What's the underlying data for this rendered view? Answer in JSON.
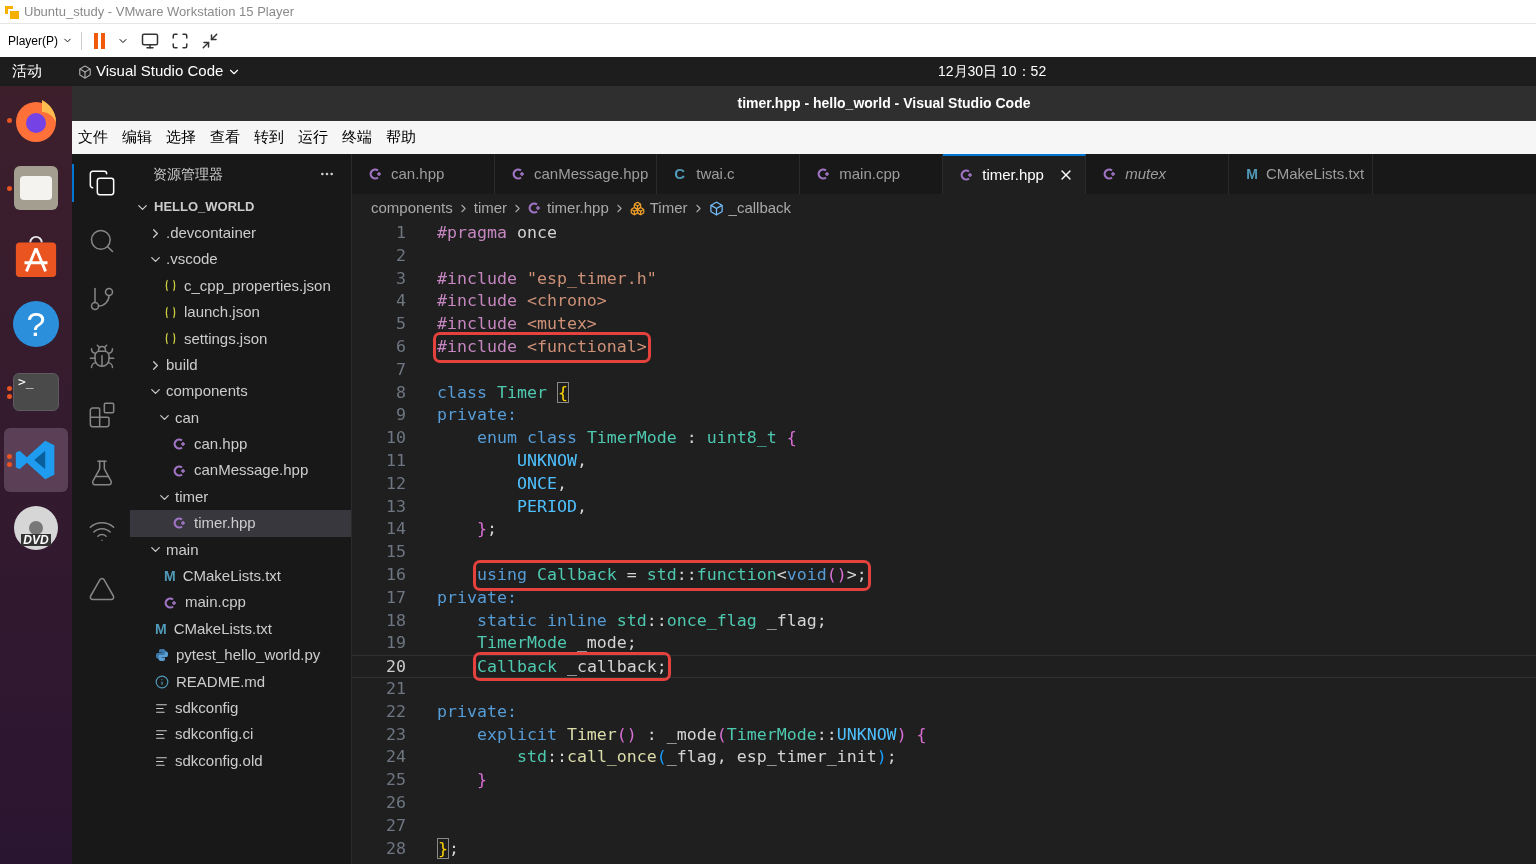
{
  "vm_window": {
    "title": "Ubuntu_study - VMware Workstation 15 Player",
    "player_menu": "Player(P)",
    "paused": true
  },
  "top_bar": {
    "activities": "活动",
    "app_name": "Visual Studio Code",
    "clock": "12月30日  10：52"
  },
  "dock": {
    "items": [
      {
        "kind": "browser",
        "running": true,
        "multiple_windows": false,
        "selected": false
      },
      {
        "kind": "files",
        "running": true,
        "multiple_windows": false,
        "selected": false
      },
      {
        "kind": "store",
        "running": false,
        "selected": false
      },
      {
        "kind": "help",
        "glyph": "?",
        "running": false,
        "selected": false
      },
      {
        "kind": "terminal",
        "glyph": ">_",
        "running": true,
        "multiple_windows": true,
        "selected": false
      },
      {
        "kind": "vscode",
        "running": true,
        "multiple_windows": true,
        "selected": true
      },
      {
        "kind": "disc",
        "glyph": "DVD",
        "running": false,
        "selected": false
      }
    ]
  },
  "window": {
    "title": "timer.hpp - hello_world - Visual Studio Code"
  },
  "menu": [
    "文件",
    "编辑",
    "选择",
    "查看",
    "转到",
    "运行",
    "终端",
    "帮助"
  ],
  "activity_bar": [
    {
      "kind": "explorer",
      "selected": true
    },
    {
      "kind": "search",
      "selected": false
    },
    {
      "kind": "source-control",
      "selected": false
    },
    {
      "kind": "debug",
      "selected": false
    },
    {
      "kind": "extensions",
      "selected": false
    },
    {
      "kind": "testing",
      "selected": false
    },
    {
      "kind": "espressif",
      "selected": false
    },
    {
      "kind": "tools",
      "selected": false
    }
  ],
  "sidebar": {
    "title": "资源管理器",
    "root": {
      "label": "HELLO_WORLD",
      "expanded": true,
      "children": [
        {
          "label": ".devcontainer",
          "kind": "folder",
          "expanded": false
        },
        {
          "label": ".vscode",
          "kind": "folder",
          "expanded": true,
          "children": [
            {
              "label": "c_cpp_properties.json",
              "kind": "json",
              "selected": false
            },
            {
              "label": "launch.json",
              "kind": "json",
              "selected": false
            },
            {
              "label": "settings.json",
              "kind": "json",
              "selected": false
            }
          ]
        },
        {
          "label": "build",
          "kind": "folder",
          "expanded": false
        },
        {
          "label": "components",
          "kind": "folder",
          "expanded": true,
          "children": [
            {
              "label": "can",
              "kind": "folder",
              "expanded": true,
              "children": [
                {
                  "label": "can.hpp",
                  "kind": "cpp",
                  "selected": false
                },
                {
                  "label": "canMessage.hpp",
                  "kind": "cpp",
                  "selected": false
                }
              ]
            },
            {
              "label": "timer",
              "kind": "folder",
              "expanded": true,
              "children": [
                {
                  "label": "timer.hpp",
                  "kind": "cpp",
                  "selected": true
                }
              ]
            }
          ]
        },
        {
          "label": "main",
          "kind": "folder",
          "expanded": true,
          "children": [
            {
              "label": "CMakeLists.txt",
              "kind": "cmake",
              "glyph": "M",
              "selected": false
            },
            {
              "label": "main.cpp",
              "kind": "cpp",
              "selected": false
            }
          ]
        },
        {
          "label": "CMakeLists.txt",
          "kind": "cmake",
          "glyph": "M",
          "selected": false
        },
        {
          "label": "pytest_hello_world.py",
          "kind": "python",
          "selected": false
        },
        {
          "label": "README.md",
          "kind": "info",
          "selected": false
        },
        {
          "label": "sdkconfig",
          "kind": "lines",
          "selected": false
        },
        {
          "label": "sdkconfig.ci",
          "kind": "lines",
          "selected": false
        },
        {
          "label": "sdkconfig.old",
          "kind": "lines",
          "selected": false
        }
      ]
    }
  },
  "tabs": [
    {
      "label": "can.hpp",
      "kind": "cpp",
      "selected": false,
      "italic": false
    },
    {
      "label": "canMessage.hpp",
      "kind": "cpp",
      "selected": false,
      "italic": false
    },
    {
      "label": "twai.c",
      "kind": "c",
      "glyph": "C",
      "selected": false,
      "italic": false
    },
    {
      "label": "main.cpp",
      "kind": "cpp",
      "selected": false,
      "italic": false
    },
    {
      "label": "timer.hpp",
      "kind": "cpp",
      "selected": true,
      "italic": false
    },
    {
      "label": "mutex",
      "kind": "cpp",
      "selected": false,
      "italic": true
    },
    {
      "label": "CMakeLists.txt",
      "kind": "cmake",
      "glyph": "M",
      "selected": false,
      "italic": false
    }
  ],
  "breadcrumb": [
    {
      "label": "components",
      "kind": "folder"
    },
    {
      "label": "timer",
      "kind": "folder"
    },
    {
      "label": "timer.hpp",
      "kind": "cpp"
    },
    {
      "label": "Timer",
      "kind": "class"
    },
    {
      "label": "_callback",
      "kind": "field"
    }
  ],
  "code": [
    {
      "number": "1",
      "boxed": false,
      "current": false,
      "tokens": [
        {
          "text": "#pragma",
          "kind": "pre"
        },
        {
          "text": " once",
          "kind": "plain"
        }
      ]
    },
    {
      "number": "2",
      "boxed": false,
      "current": false
    },
    {
      "number": "3",
      "boxed": false,
      "current": false,
      "tokens": [
        {
          "text": "#include",
          "kind": "pre"
        },
        {
          "text": " \"esp_timer.h\"",
          "kind": "str"
        }
      ]
    },
    {
      "number": "4",
      "boxed": false,
      "current": false,
      "tokens": [
        {
          "text": "#include",
          "kind": "pre"
        },
        {
          "text": " <chrono>",
          "kind": "str"
        }
      ]
    },
    {
      "number": "5",
      "boxed": false,
      "current": false,
      "tokens": [
        {
          "text": "#include",
          "kind": "pre"
        },
        {
          "text": " <mutex>",
          "kind": "str"
        }
      ]
    },
    {
      "number": "6",
      "boxed": true,
      "current": false,
      "tokens": [
        {
          "text": "#include",
          "kind": "pre"
        },
        {
          "text": " <functional>",
          "kind": "str"
        }
      ]
    },
    {
      "number": "7",
      "boxed": false,
      "current": false
    },
    {
      "number": "8",
      "boxed": false,
      "current": false,
      "tokens": [
        {
          "text": "class ",
          "kind": "kw"
        },
        {
          "text": "Timer ",
          "kind": "type"
        },
        {
          "text": "{",
          "kind": "b1",
          "matched": true
        }
      ]
    },
    {
      "number": "9",
      "boxed": false,
      "current": false,
      "tokens": [
        {
          "text": "private:",
          "kind": "kw"
        }
      ]
    },
    {
      "number": "10",
      "boxed": false,
      "current": false,
      "tokens": [
        {
          "text": "    enum class ",
          "kind": "kw"
        },
        {
          "text": "TimerMode",
          "kind": "type"
        },
        {
          "text": " : ",
          "kind": "plain"
        },
        {
          "text": "uint8_t ",
          "kind": "type"
        },
        {
          "text": "{",
          "kind": "b2"
        }
      ]
    },
    {
      "number": "11",
      "boxed": false,
      "current": false,
      "tokens": [
        {
          "text": "        UNKNOW",
          "kind": "enum"
        },
        {
          "text": ",",
          "kind": "plain"
        }
      ]
    },
    {
      "number": "12",
      "boxed": false,
      "current": false,
      "tokens": [
        {
          "text": "        ONCE",
          "kind": "enum"
        },
        {
          "text": ",",
          "kind": "plain"
        }
      ]
    },
    {
      "number": "13",
      "boxed": false,
      "current": false,
      "tokens": [
        {
          "text": "        PERIOD",
          "kind": "enum"
        },
        {
          "text": ",",
          "kind": "plain"
        }
      ]
    },
    {
      "number": "14",
      "boxed": false,
      "current": false,
      "tokens": [
        {
          "text": "    }",
          "kind": "b2"
        },
        {
          "text": ";",
          "kind": "plain"
        }
      ]
    },
    {
      "number": "15",
      "boxed": false,
      "current": false
    },
    {
      "number": "16",
      "boxed": true,
      "current": false,
      "tokens": [
        {
          "text": "    using ",
          "kind": "kw"
        },
        {
          "text": "Callback",
          "kind": "type"
        },
        {
          "text": " = ",
          "kind": "plain"
        },
        {
          "text": "std",
          "kind": "type"
        },
        {
          "text": "::",
          "kind": "plain"
        },
        {
          "text": "function",
          "kind": "type"
        },
        {
          "text": "<",
          "kind": "plain"
        },
        {
          "text": "void",
          "kind": "kw"
        },
        {
          "text": "()",
          "kind": "b2"
        },
        {
          "text": ">;",
          "kind": "plain"
        }
      ]
    },
    {
      "number": "17",
      "boxed": false,
      "current": false,
      "tokens": [
        {
          "text": "private:",
          "kind": "kw"
        }
      ]
    },
    {
      "number": "18",
      "boxed": false,
      "current": false,
      "tokens": [
        {
          "text": "    static inline ",
          "kind": "kw"
        },
        {
          "text": "std",
          "kind": "type"
        },
        {
          "text": "::",
          "kind": "plain"
        },
        {
          "text": "once_flag",
          "kind": "type"
        },
        {
          "text": " _flag;",
          "kind": "plain"
        }
      ]
    },
    {
      "number": "19",
      "boxed": false,
      "current": false,
      "tokens": [
        {
          "text": "    TimerMode",
          "kind": "type"
        },
        {
          "text": " _mode;",
          "kind": "plain"
        }
      ]
    },
    {
      "number": "20",
      "boxed": true,
      "current": true,
      "tokens": [
        {
          "text": "    Callback",
          "kind": "type"
        },
        {
          "text": " _callback;",
          "kind": "plain"
        }
      ]
    },
    {
      "number": "21",
      "boxed": false,
      "current": false
    },
    {
      "number": "22",
      "boxed": false,
      "current": false,
      "tokens": [
        {
          "text": "private:",
          "kind": "kw"
        }
      ]
    },
    {
      "number": "23",
      "boxed": false,
      "current": false,
      "tokens": [
        {
          "text": "    explicit ",
          "kind": "kw"
        },
        {
          "text": "Timer",
          "kind": "fn"
        },
        {
          "text": "()",
          "kind": "b2"
        },
        {
          "text": " : _mode",
          "kind": "plain"
        },
        {
          "text": "(",
          "kind": "b2"
        },
        {
          "text": "TimerMode",
          "kind": "type"
        },
        {
          "text": "::",
          "kind": "plain"
        },
        {
          "text": "UNKNOW",
          "kind": "enum"
        },
        {
          "text": ") {",
          "kind": "b2"
        }
      ]
    },
    {
      "number": "24",
      "boxed": false,
      "current": false,
      "tokens": [
        {
          "text": "        std",
          "kind": "type"
        },
        {
          "text": "::",
          "kind": "plain"
        },
        {
          "text": "call_once",
          "kind": "fn"
        },
        {
          "text": "(",
          "kind": "b3"
        },
        {
          "text": "_flag, esp_timer_init",
          "kind": "plain"
        },
        {
          "text": ")",
          "kind": "b3"
        },
        {
          "text": ";",
          "kind": "plain"
        }
      ]
    },
    {
      "number": "25",
      "boxed": false,
      "current": false,
      "tokens": [
        {
          "text": "    }",
          "kind": "b2"
        }
      ]
    },
    {
      "number": "26",
      "boxed": false,
      "current": false
    },
    {
      "number": "27",
      "boxed": false,
      "current": false
    },
    {
      "number": "28",
      "boxed": false,
      "current": false,
      "tokens": [
        {
          "text": "}",
          "kind": "b1",
          "matched": true
        },
        {
          "text": ";",
          "kind": "plain"
        }
      ]
    }
  ]
}
